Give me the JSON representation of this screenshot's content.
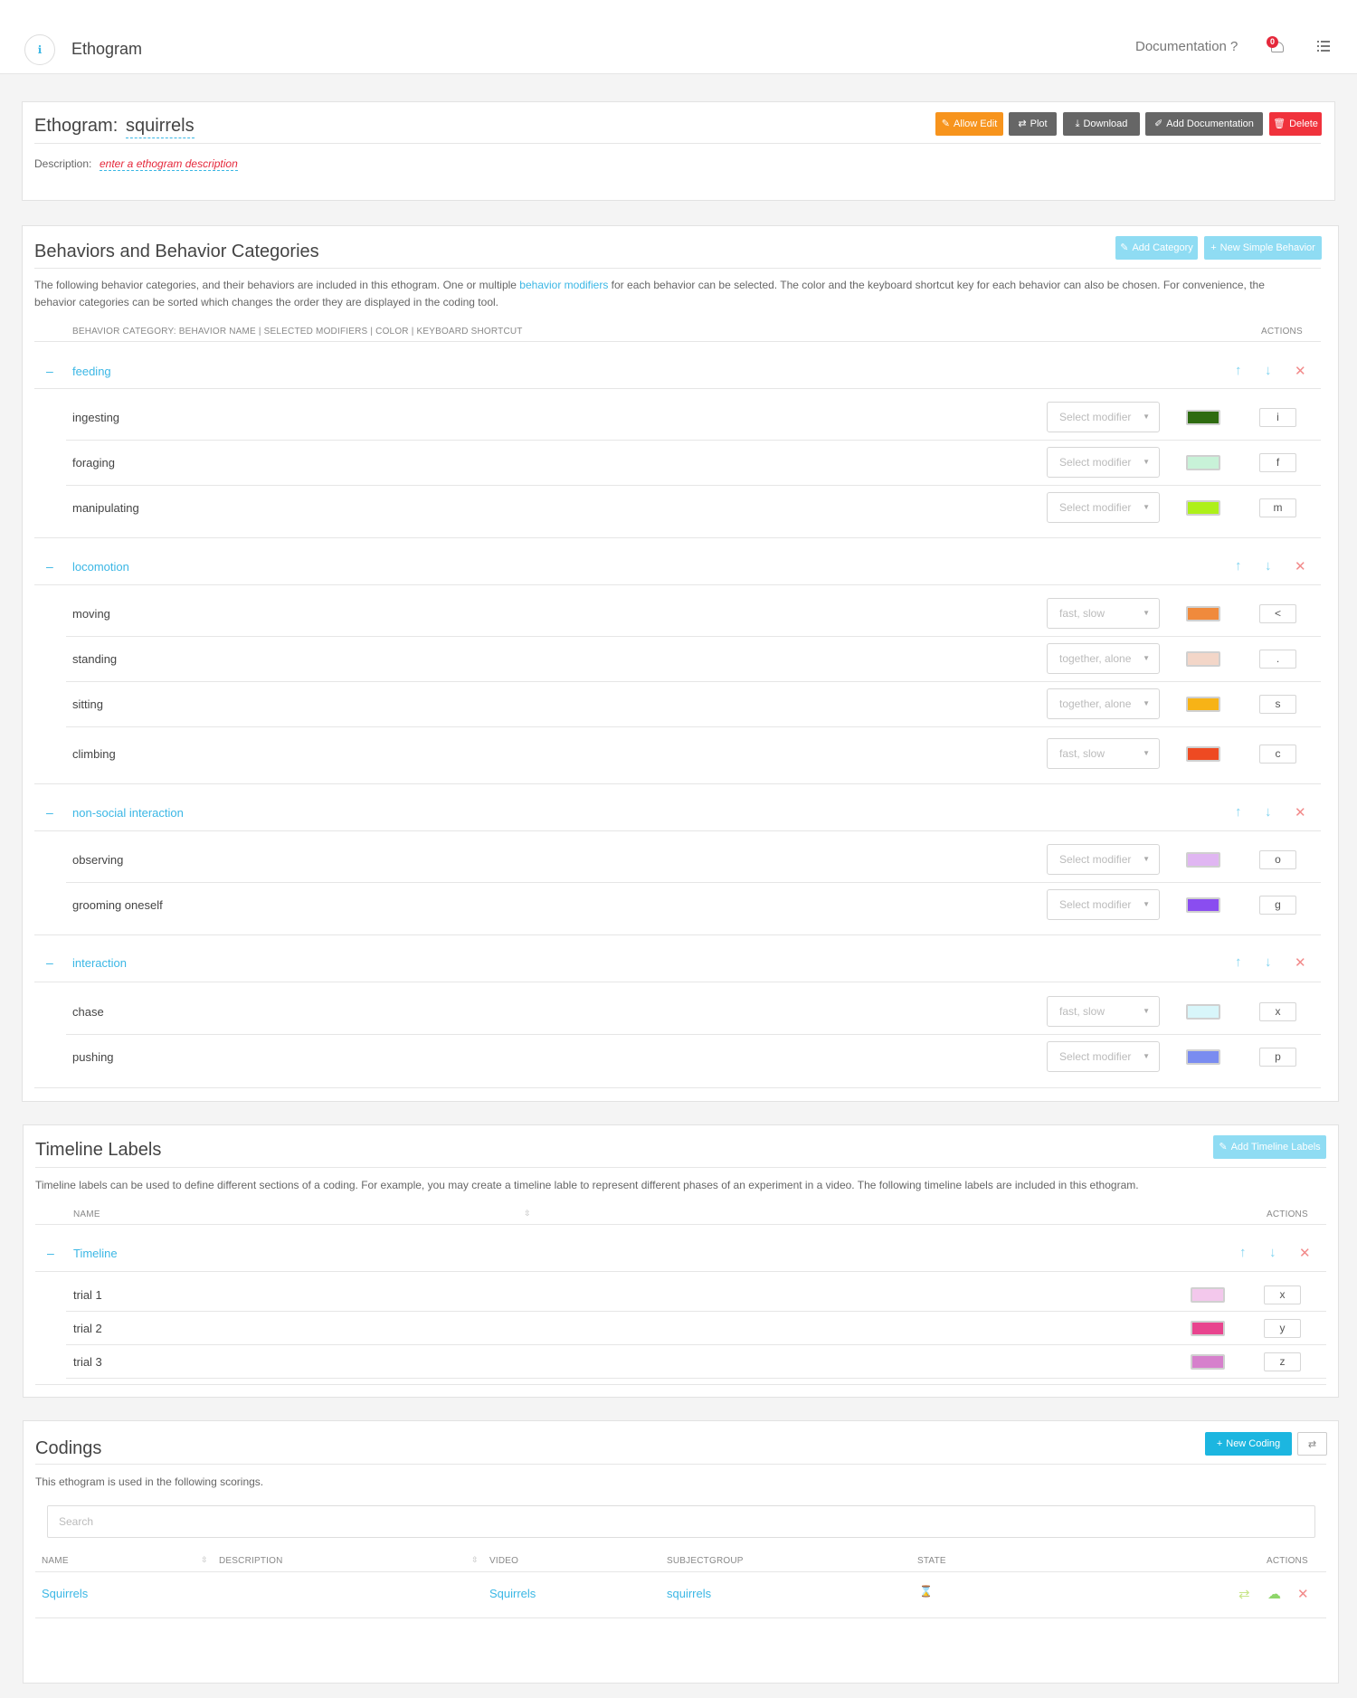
{
  "header": {
    "logo": "ℹ",
    "title": "Ethogram",
    "documentation": "Documentation ?",
    "notification_count": "0"
  },
  "ethogram": {
    "label": "Ethogram:",
    "name": "squirrels",
    "buttons": {
      "allow_edit": "Allow Edit",
      "plot": "Plot",
      "download": "Download",
      "add_documentation": "Add Documentation",
      "delete": "Delete"
    },
    "description_label": "Description:",
    "description_value": "enter a ethogram description"
  },
  "behaviors": {
    "title": "Behaviors and Behavior Categories",
    "add_category": "Add Category",
    "new_simple_behavior": "New Simple Behavior",
    "intro_before_link": "The following behavior categories, and their behaviors are included in this ethogram. One or multiple ",
    "intro_link": "behavior modifiers",
    "intro_after_link": " for each behavior can be selected. The color and the keyboard shortcut key for each behavior can also be chosen. For convenience, the behavior categories can be sorted which changes the order they are displayed in the coding tool.",
    "column_header": "BEHAVIOR CATEGORY: BEHAVIOR NAME | SELECTED MODIFIERS | COLOR | KEYBOARD SHORTCUT",
    "actions_header": "ACTIONS",
    "categories": [
      {
        "name": "feeding",
        "items": [
          {
            "name": "ingesting",
            "modifier": "Select modifier",
            "color": "#2e6b10",
            "key": "i"
          },
          {
            "name": "foraging",
            "modifier": "Select modifier",
            "color": "#c8f2d8",
            "key": "f"
          },
          {
            "name": "manipulating",
            "modifier": "Select modifier",
            "color": "#aef01a",
            "key": "m"
          }
        ]
      },
      {
        "name": "locomotion",
        "items": [
          {
            "name": "moving",
            "modifier": "fast, slow",
            "color": "#f08a3c",
            "key": "<"
          },
          {
            "name": "standing",
            "modifier": "together, alone",
            "color": "#f3d6c8",
            "key": "."
          },
          {
            "name": "sitting",
            "modifier": "together, alone",
            "color": "#f7b316",
            "key": "s"
          },
          {
            "name": "climbing",
            "modifier": "fast, slow",
            "color": "#ee4a22",
            "key": "c"
          }
        ]
      },
      {
        "name": "non-social interaction",
        "items": [
          {
            "name": "observing",
            "modifier": "Select modifier",
            "color": "#e0b6f2",
            "key": "o"
          },
          {
            "name": "grooming oneself",
            "modifier": "Select modifier",
            "color": "#8a4df0",
            "key": "g"
          }
        ]
      },
      {
        "name": "interaction",
        "items": [
          {
            "name": "chase",
            "modifier": "fast, slow",
            "color": "#d8f6fa",
            "key": "x"
          },
          {
            "name": "pushing",
            "modifier": "Select modifier",
            "color": "#7a8cf0",
            "key": "p"
          }
        ]
      }
    ]
  },
  "timeline": {
    "title": "Timeline Labels",
    "add_button": "Add Timeline Labels",
    "intro": "Timeline labels can be used to define different sections of a coding. For example, you may create a timeline lable to represent different phases of an experiment in a video. The following timeline labels are included in this ethogram.",
    "name_header": "NAME",
    "actions_header": "ACTIONS",
    "category": "Timeline",
    "items": [
      {
        "name": "trial 1",
        "color": "#f3c8ec",
        "key": "x"
      },
      {
        "name": "trial 2",
        "color": "#e8448e",
        "key": "y"
      },
      {
        "name": "trial 3",
        "color": "#d680cc",
        "key": "z"
      }
    ]
  },
  "codings": {
    "title": "Codings",
    "new_coding": "New Coding",
    "intro": "This ethogram is used in the following scorings.",
    "search_placeholder": "Search",
    "headers": {
      "name": "NAME",
      "description": "DESCRIPTION",
      "video": "VIDEO",
      "subjectgroup": "SUBJECTGROUP",
      "state": "STATE",
      "actions": "ACTIONS"
    },
    "rows": [
      {
        "name": "Squirrels",
        "description": "",
        "video": "Squirrels",
        "subjectgroup": "squirrels",
        "state": "⌛"
      }
    ]
  },
  "icons": {
    "edit": "✎",
    "plot": "⇄",
    "download": "⤓",
    "doc": "✐",
    "trash": "🗑",
    "plus": "+",
    "up": "↑",
    "down": "↓",
    "del": "✕",
    "collapse": "–",
    "caret": "▼",
    "sort": "⇳"
  }
}
